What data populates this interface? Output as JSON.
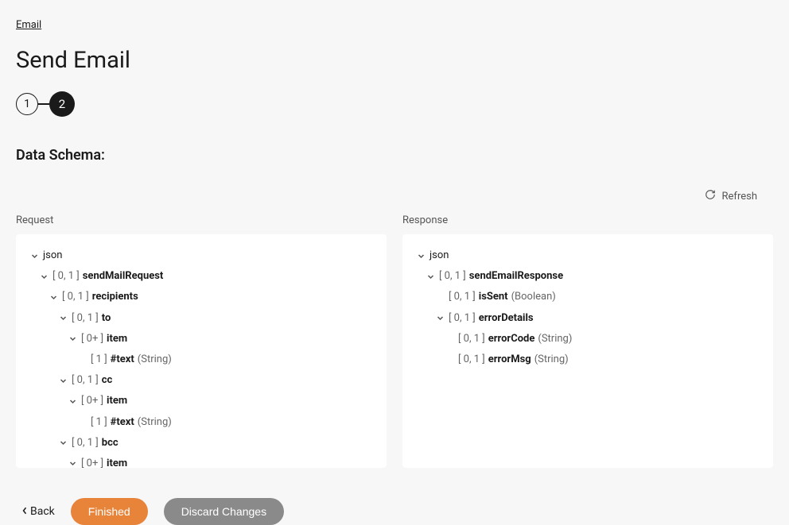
{
  "breadcrumb": {
    "label": "Email"
  },
  "page_title": "Send Email",
  "steps": {
    "one": "1",
    "two": "2"
  },
  "section_title": "Data Schema:",
  "labels": {
    "request": "Request",
    "response": "Response",
    "refresh": "Refresh"
  },
  "request_tree": [
    {
      "indent": 0,
      "chev": true,
      "card": "",
      "name": "json",
      "root": true,
      "type": ""
    },
    {
      "indent": 1,
      "chev": true,
      "card": "[ 0, 1 ]",
      "name": "sendMailRequest",
      "type": ""
    },
    {
      "indent": 2,
      "chev": true,
      "card": "[ 0, 1 ]",
      "name": "recipients",
      "type": ""
    },
    {
      "indent": 3,
      "chev": true,
      "card": "[ 0, 1 ]",
      "name": "to",
      "type": ""
    },
    {
      "indent": 4,
      "chev": true,
      "card": "[ 0+ ]",
      "name": "item",
      "type": ""
    },
    {
      "indent": 5,
      "chev": false,
      "card": "[ 1 ]",
      "name": "#text",
      "type": "(String)"
    },
    {
      "indent": 3,
      "chev": true,
      "card": "[ 0, 1 ]",
      "name": "cc",
      "type": ""
    },
    {
      "indent": 4,
      "chev": true,
      "card": "[ 0+ ]",
      "name": "item",
      "type": ""
    },
    {
      "indent": 5,
      "chev": false,
      "card": "[ 1 ]",
      "name": "#text",
      "type": "(String)"
    },
    {
      "indent": 3,
      "chev": true,
      "card": "[ 0, 1 ]",
      "name": "bcc",
      "type": ""
    },
    {
      "indent": 4,
      "chev": true,
      "card": "[ 0+ ]",
      "name": "item",
      "type": ""
    }
  ],
  "response_tree": [
    {
      "indent": 0,
      "chev": true,
      "card": "",
      "name": "json",
      "root": true,
      "type": ""
    },
    {
      "indent": 1,
      "chev": true,
      "card": "[ 0, 1 ]",
      "name": "sendEmailResponse",
      "type": ""
    },
    {
      "indent": 2,
      "chev": false,
      "card": "[ 0, 1 ]",
      "name": "isSent",
      "type": "(Boolean)"
    },
    {
      "indent": 2,
      "chev": true,
      "card": "[ 0, 1 ]",
      "name": "errorDetails",
      "type": ""
    },
    {
      "indent": 3,
      "chev": false,
      "card": "[ 0, 1 ]",
      "name": "errorCode",
      "type": "(String)"
    },
    {
      "indent": 3,
      "chev": false,
      "card": "[ 0, 1 ]",
      "name": "errorMsg",
      "type": "(String)"
    }
  ],
  "footer": {
    "back": "Back",
    "finished": "Finished",
    "discard": "Discard Changes"
  }
}
